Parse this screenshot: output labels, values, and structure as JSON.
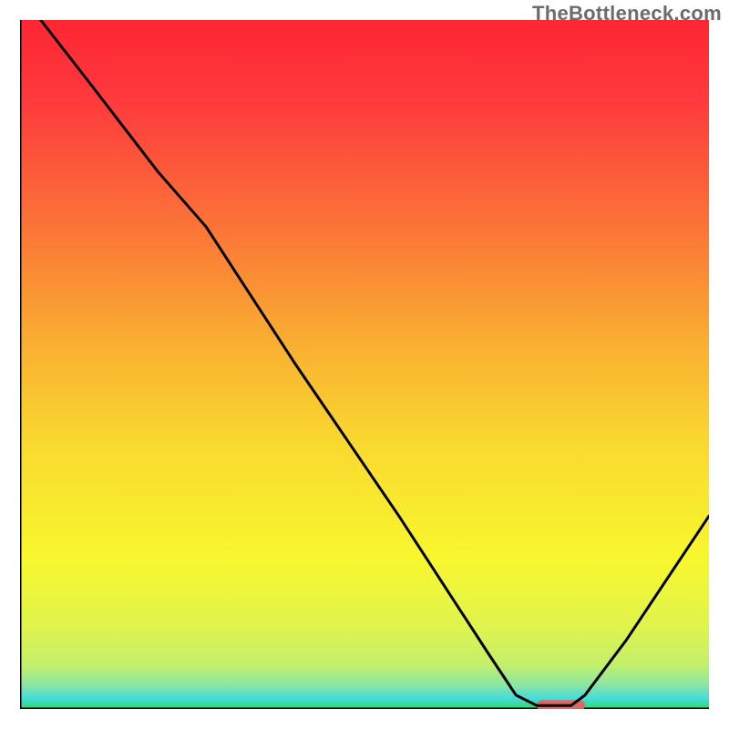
{
  "watermark": "TheBottleneck.com",
  "chart_data": {
    "type": "line",
    "title": "",
    "xlabel": "",
    "ylabel": "",
    "xlim": [
      0,
      100
    ],
    "ylim": [
      0,
      100
    ],
    "series": [
      {
        "name": "bottleneck-curve",
        "x": [
          3,
          10,
          20,
          27,
          40,
          55,
          68,
          72,
          75,
          80,
          82,
          88,
          100
        ],
        "y": [
          100,
          91,
          78,
          70,
          50,
          28,
          8,
          2,
          0.5,
          0.5,
          2,
          10,
          28
        ]
      }
    ],
    "marker": {
      "name": "optimal-range",
      "x_start": 75,
      "x_end": 82,
      "y": 0.5,
      "color": "#e06666"
    },
    "background_gradient": {
      "stops": [
        {
          "offset": 0.0,
          "color": "#fe2633"
        },
        {
          "offset": 0.12,
          "color": "#fe3b3d"
        },
        {
          "offset": 0.3,
          "color": "#fb7437"
        },
        {
          "offset": 0.48,
          "color": "#f9b231"
        },
        {
          "offset": 0.62,
          "color": "#f9da2f"
        },
        {
          "offset": 0.78,
          "color": "#f8f72e"
        },
        {
          "offset": 0.88,
          "color": "#e0f44c"
        },
        {
          "offset": 0.935,
          "color": "#c4ef6b"
        },
        {
          "offset": 0.965,
          "color": "#8be6a3"
        },
        {
          "offset": 0.985,
          "color": "#44dcda"
        },
        {
          "offset": 1.0,
          "color": "#2fd863"
        }
      ]
    },
    "axes": {
      "show_ticks": false,
      "show_grid": false,
      "line_color": "#000000",
      "line_width": 3
    }
  }
}
